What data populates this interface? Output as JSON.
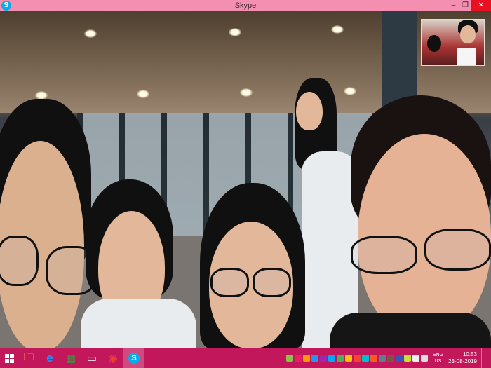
{
  "window": {
    "title": "Skype",
    "logo_glyph": "S",
    "minimize_glyph": "–",
    "maximize_glyph": "❐",
    "close_glyph": "✕"
  },
  "call": {
    "remote_video": "group-video-call",
    "self_view": "self-view-thumbnail"
  },
  "taskbar": {
    "apps": [
      {
        "name": "file-explorer-icon",
        "glyph": "🗀",
        "color": "#f4c542"
      },
      {
        "name": "internet-explorer-icon",
        "glyph": "e",
        "color": "#1e90ff"
      },
      {
        "name": "store-icon",
        "glyph": "▦",
        "color": "#2e9d3b"
      },
      {
        "name": "monitor-icon",
        "glyph": "▭",
        "color": "#e0e0e0"
      },
      {
        "name": "chrome-icon",
        "glyph": "◉",
        "color": "#ea4335"
      },
      {
        "name": "skype-icon",
        "glyph": "S",
        "color": "#00aff0"
      }
    ],
    "language": "ENG",
    "region": "US",
    "time": "10:53",
    "date": "23-08-2019"
  },
  "colors": {
    "titlebar": "#f48fb1",
    "taskbar": "#c2185b",
    "close": "#e81123"
  }
}
